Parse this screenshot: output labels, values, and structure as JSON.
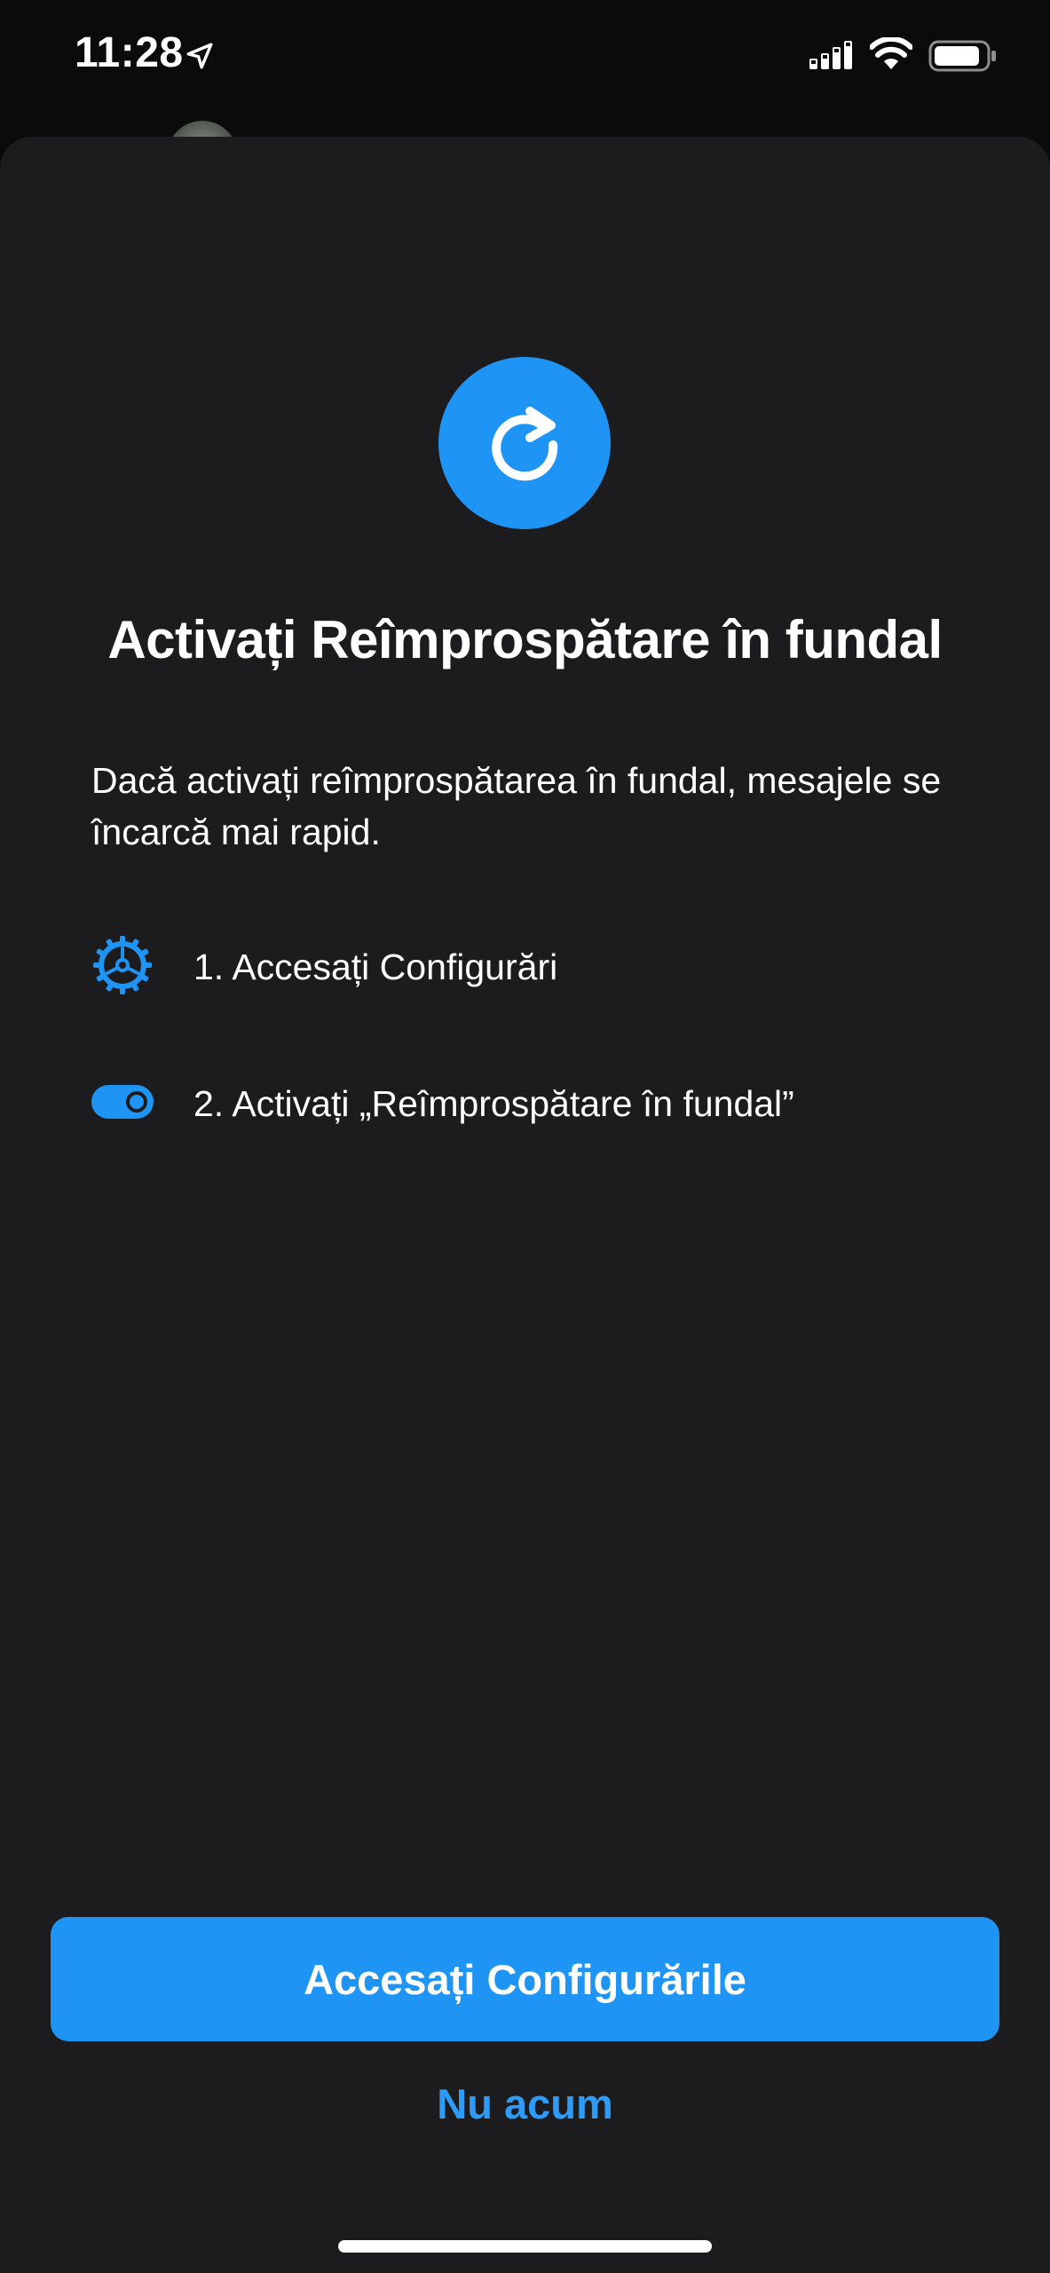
{
  "status_bar": {
    "time": "11:28",
    "icons": [
      "location-arrow-icon",
      "cellular-signal-icon",
      "wifi-icon",
      "battery-icon"
    ]
  },
  "colors": {
    "accent": "#1e94f5",
    "sheet_background": "#1c1c1e",
    "link": "#2e9cf6"
  },
  "sheet": {
    "hero_icon": "refresh-icon",
    "title": "Activați Reîmprospătare în fundal",
    "description": "Dacă activați reîmprospătarea în fundal, mesajele se încarcă mai rapid.",
    "steps": [
      {
        "icon": "gear-icon",
        "label": "1. Accesați Configurări"
      },
      {
        "icon": "toggle-icon",
        "label": "2. Activați „Reîmprospătare în fundal”"
      }
    ],
    "primary_button_label": "Accesați Configurările",
    "secondary_button_label": "Nu acum"
  }
}
